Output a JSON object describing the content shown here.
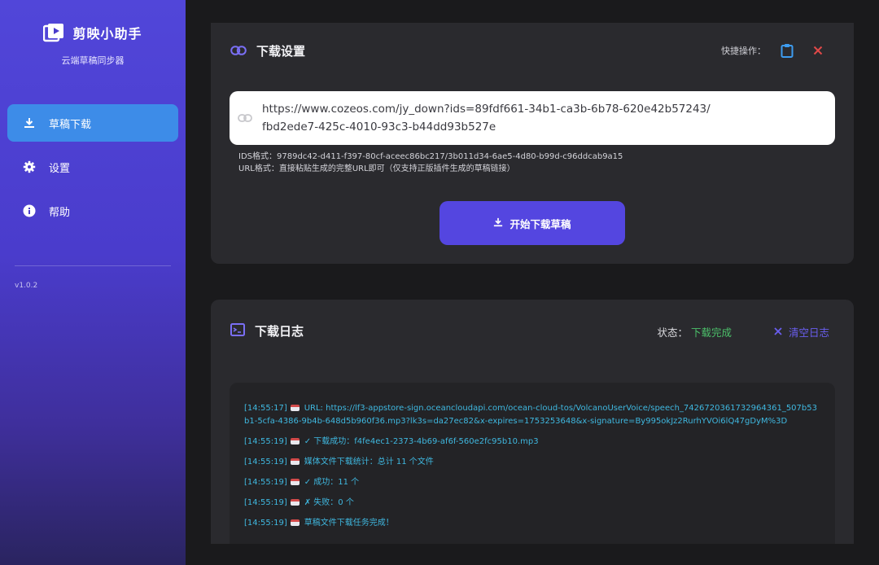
{
  "app": {
    "title": "剪映小助手",
    "subtitle": "云端草稿同步器",
    "version": "v1.0.2"
  },
  "sidebar": {
    "items": [
      {
        "label": "草稿下载",
        "icon": "download-icon",
        "active": true
      },
      {
        "label": "设置",
        "icon": "gear-icon",
        "active": false
      },
      {
        "label": "帮助",
        "icon": "info-icon",
        "active": false
      }
    ]
  },
  "download_settings": {
    "title": "下载设置",
    "quick_label": "快捷操作：",
    "url_value": "https://www.cozeos.com/jy_down?ids=89fdf661-34b1-ca3b-6b78-620e42b57243/\nfbd2ede7-425c-4010-93c3-b44dd93b527e",
    "hint_ids": "IDS格式：9789dc42-d411-f397-80cf-aceec86bc217/3b011d34-6ae5-4d80-b99d-c96ddcab9a15",
    "hint_url": "URL格式：直接粘贴生成的完整URL即可（仅支持正版插件生成的草稿链接）",
    "start_label": "开始下载草稿"
  },
  "log": {
    "title": "下载日志",
    "status_label": "状态：",
    "status_value": "下载完成",
    "clear_label": "清空日志",
    "lines": [
      "[14:55:17]  URL: https://lf3-appstore-sign.oceancloudapi.com/ocean-cloud-tos/VolcanoUserVoice/speech_7426720361732964361_507b53b1-5cfa-4386-9b4b-648d5b960f36.mp3?lk3s=da27ec82&x-expires=1753253648&x-signature=By995okJz2RurhYVOi6lQ47gDyM%3D",
      "[14:55:19]  ✓ 下载成功：f4fe4ec1-2373-4b69-af6f-560e2fc95b10.mp3",
      "[14:55:19]  媒体文件下载统计：总计 11 个文件",
      "[14:55:19]   ✓ 成功：11 个",
      "[14:55:19]   ✗ 失败：0 个",
      "[14:55:19]  草稿文件下载任务完成！"
    ]
  },
  "colors": {
    "sidebar_top": "#5146d9",
    "active_nav": "#3d8ce8",
    "primary_button": "#5446e0",
    "status_ok": "#4cc06a",
    "log_text": "#3fb8e0",
    "close_red": "#e04848"
  }
}
